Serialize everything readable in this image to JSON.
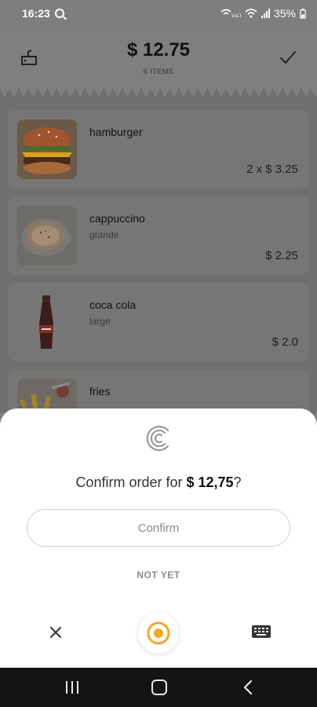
{
  "status_bar": {
    "time": "16:23",
    "battery": "35%",
    "icons": [
      "search-icon",
      "wifi-call-icon",
      "wifi-icon",
      "signal-icon",
      "battery-icon"
    ]
  },
  "header": {
    "total": "$ 12.75",
    "items_count": "6 ITEMS",
    "icons": [
      "cart-icon",
      "check-icon"
    ]
  },
  "items": [
    {
      "name": "hamburger",
      "subtitle": "",
      "price": "2 x $ 3.25",
      "image": "hamburger-photo"
    },
    {
      "name": "cappuccino",
      "subtitle": "grande",
      "price": "$ 2.25",
      "image": "cappuccino-photo"
    },
    {
      "name": "coca cola",
      "subtitle": "large",
      "price": "$ 2.0",
      "image": "coca-cola-photo"
    },
    {
      "name": "fries",
      "subtitle": "",
      "price": "",
      "image": "fries-photo"
    }
  ],
  "sheet": {
    "question_prefix": "Confirm order for ",
    "question_amount": "$ 12,75",
    "question_suffix": "?",
    "confirm_label": "Confirm",
    "not_yet_label": "NOT YET",
    "icons": [
      "brand-logo-icon",
      "close-icon",
      "microphone-icon",
      "keyboard-icon"
    ],
    "accent_color": "#f5a623"
  },
  "nav_bar": {
    "icons": [
      "recent-apps-icon",
      "home-icon",
      "back-icon"
    ]
  }
}
